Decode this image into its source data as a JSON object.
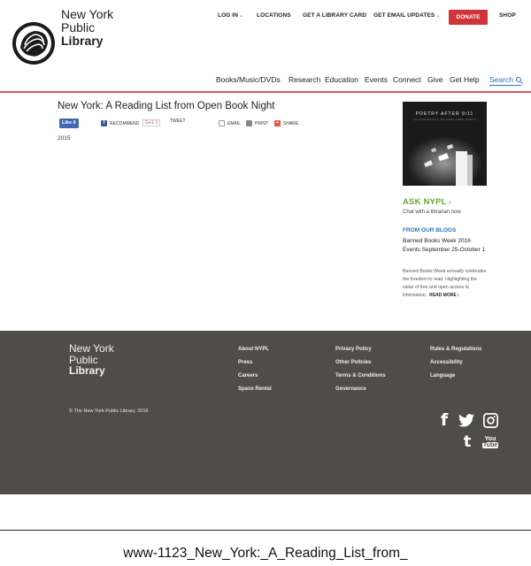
{
  "logo": {
    "line1": "New York",
    "line2": "Public",
    "line3": "Library"
  },
  "top_links": {
    "login": "LOG IN",
    "locations": "LOCATIONS",
    "library_card": "GET A LIBRARY CARD",
    "email_updates": "GET EMAIL UPDATES",
    "donate": "DONATE",
    "shop": "SHOP"
  },
  "nav": [
    "Books/Music/DVDs",
    "Research",
    "Education",
    "Events",
    "Connect",
    "Give",
    "Get Help",
    "Search"
  ],
  "page": {
    "title": "New York: A Reading List from Open Book Night",
    "year": "2015"
  },
  "share": {
    "like": "Like 0",
    "recommend": "RECOMMEND",
    "gplus": "G+1",
    "gplus_count": "0",
    "tweet": "TWEET",
    "email": "EMAIL",
    "print": "PRINT",
    "share": "SHARE"
  },
  "sidebar": {
    "book_title": "POETRY AFTER 9/11",
    "book_subtitle": "AN ANTHOLOGY OF NEW YORK POETS",
    "ask_logo": "ASK NYPL",
    "ask_sub": "Chat with a librarian now",
    "blogs_heading": "FROM OUR BLOGS",
    "blog_title": "Banned Books Week 2016 Events September 25-October 1",
    "blog_excerpt": "Banned Books Week annually celebrates the freedom to read. Highlighting the value of free and open access to information,",
    "read_more": "READ MORE ›"
  },
  "footer": {
    "logo": {
      "line1": "New York",
      "line2": "Public",
      "line3": "Library"
    },
    "col1": [
      "About NYPL",
      "Press",
      "Careers",
      "Space Rental"
    ],
    "col2": [
      "Privacy Policy",
      "Other Policies",
      "Terms & Conditions",
      "Governance"
    ],
    "col3": [
      "Rules & Regulations",
      "Accessibility",
      "Language"
    ],
    "copyright": "© The New York Public Library, 2016",
    "social": {
      "facebook": "f",
      "tumblr": "t",
      "youtube_top": "You",
      "youtube_bottom": "Tube"
    }
  },
  "caption": "www-1123_New_York:_A_Reading_List_from_",
  "colors": {
    "accent_red": "#d0343a",
    "link_blue": "#2b73b5",
    "ask_green": "#6aa63a",
    "footer_bg": "#4f4d47"
  }
}
